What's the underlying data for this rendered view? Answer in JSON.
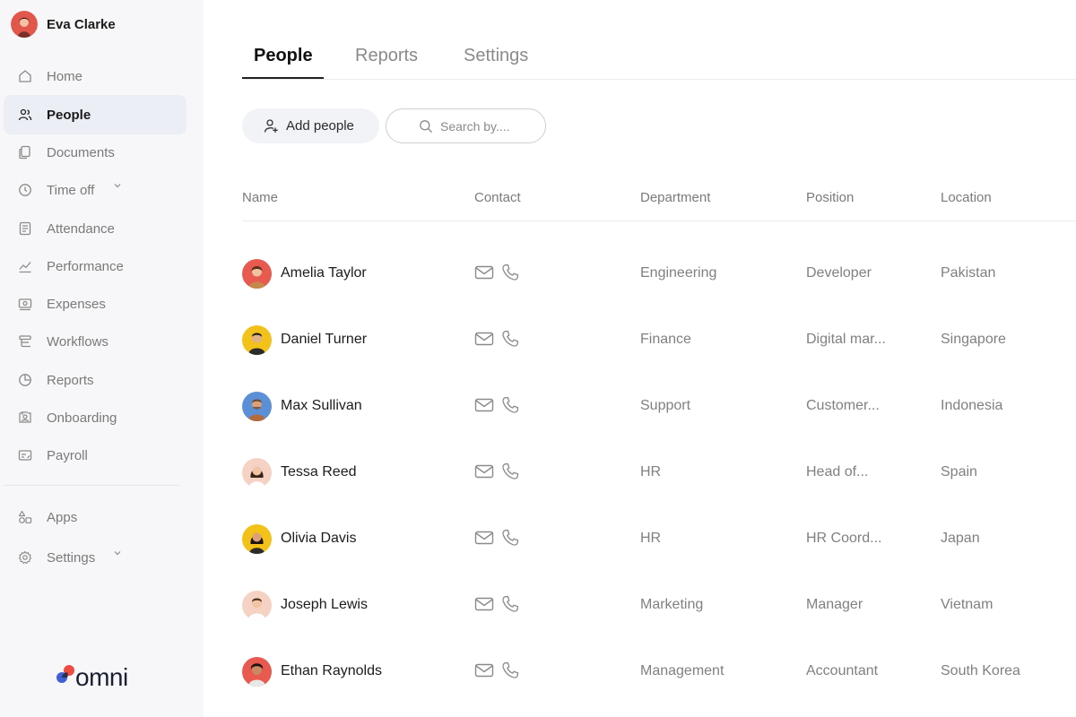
{
  "user": {
    "name": "Eva Clarke"
  },
  "sidebar": {
    "items": [
      {
        "label": "Home",
        "icon": "home-icon",
        "active": false
      },
      {
        "label": "People",
        "icon": "people-icon",
        "active": true
      },
      {
        "label": "Documents",
        "icon": "documents-icon",
        "active": false
      },
      {
        "label": "Time off",
        "icon": "clock-icon",
        "active": false,
        "has_chevron": true
      },
      {
        "label": "Attendance",
        "icon": "attendance-icon",
        "active": false
      },
      {
        "label": "Performance",
        "icon": "performance-icon",
        "active": false
      },
      {
        "label": "Expenses",
        "icon": "expenses-icon",
        "active": false
      },
      {
        "label": "Workflows",
        "icon": "workflows-icon",
        "active": false
      },
      {
        "label": "Reports",
        "icon": "reports-icon",
        "active": false
      },
      {
        "label": "Onboarding",
        "icon": "onboarding-icon",
        "active": false
      },
      {
        "label": "Payroll",
        "icon": "payroll-icon",
        "active": false
      },
      {
        "label": "Apps",
        "icon": "apps-icon",
        "active": false
      },
      {
        "label": "Settings",
        "icon": "gear-icon",
        "active": false,
        "has_chevron": true
      }
    ]
  },
  "logo": {
    "text": "omni"
  },
  "tabs": [
    {
      "label": "People",
      "active": true
    },
    {
      "label": "Reports",
      "active": false
    },
    {
      "label": "Settings",
      "active": false
    }
  ],
  "toolbar": {
    "add_label": "Add people",
    "search_placeholder": "Search by...."
  },
  "table": {
    "columns": [
      "Name",
      "Contact",
      "Department",
      "Position",
      "Location"
    ],
    "rows": [
      {
        "name": "Amelia Taylor",
        "department": "Engineering",
        "position": "Developer",
        "location": "Pakistan",
        "avatar_bg": "#e85a4f"
      },
      {
        "name": "Daniel Turner",
        "department": "Finance",
        "position": "Digital mar...",
        "location": "Singapore",
        "avatar_bg": "#f2c21b"
      },
      {
        "name": "Max Sullivan",
        "department": "Support",
        "position": "Customer...",
        "location": "Indonesia",
        "avatar_bg": "#5b8fd6"
      },
      {
        "name": "Tessa Reed",
        "department": "HR",
        "position": "Head of...",
        "location": "Spain",
        "avatar_bg": "#f6d2c4"
      },
      {
        "name": "Olivia Davis",
        "department": "HR",
        "position": "HR Coord...",
        "location": "Japan",
        "avatar_bg": "#f2c21b"
      },
      {
        "name": "Joseph Lewis",
        "department": "Marketing",
        "position": "Manager",
        "location": "Vietnam",
        "avatar_bg": "#f6d2c4"
      },
      {
        "name": "Ethan Raynolds",
        "department": "Management",
        "position": "Accountant",
        "location": "South Korea",
        "avatar_bg": "#e85a4f"
      }
    ]
  }
}
